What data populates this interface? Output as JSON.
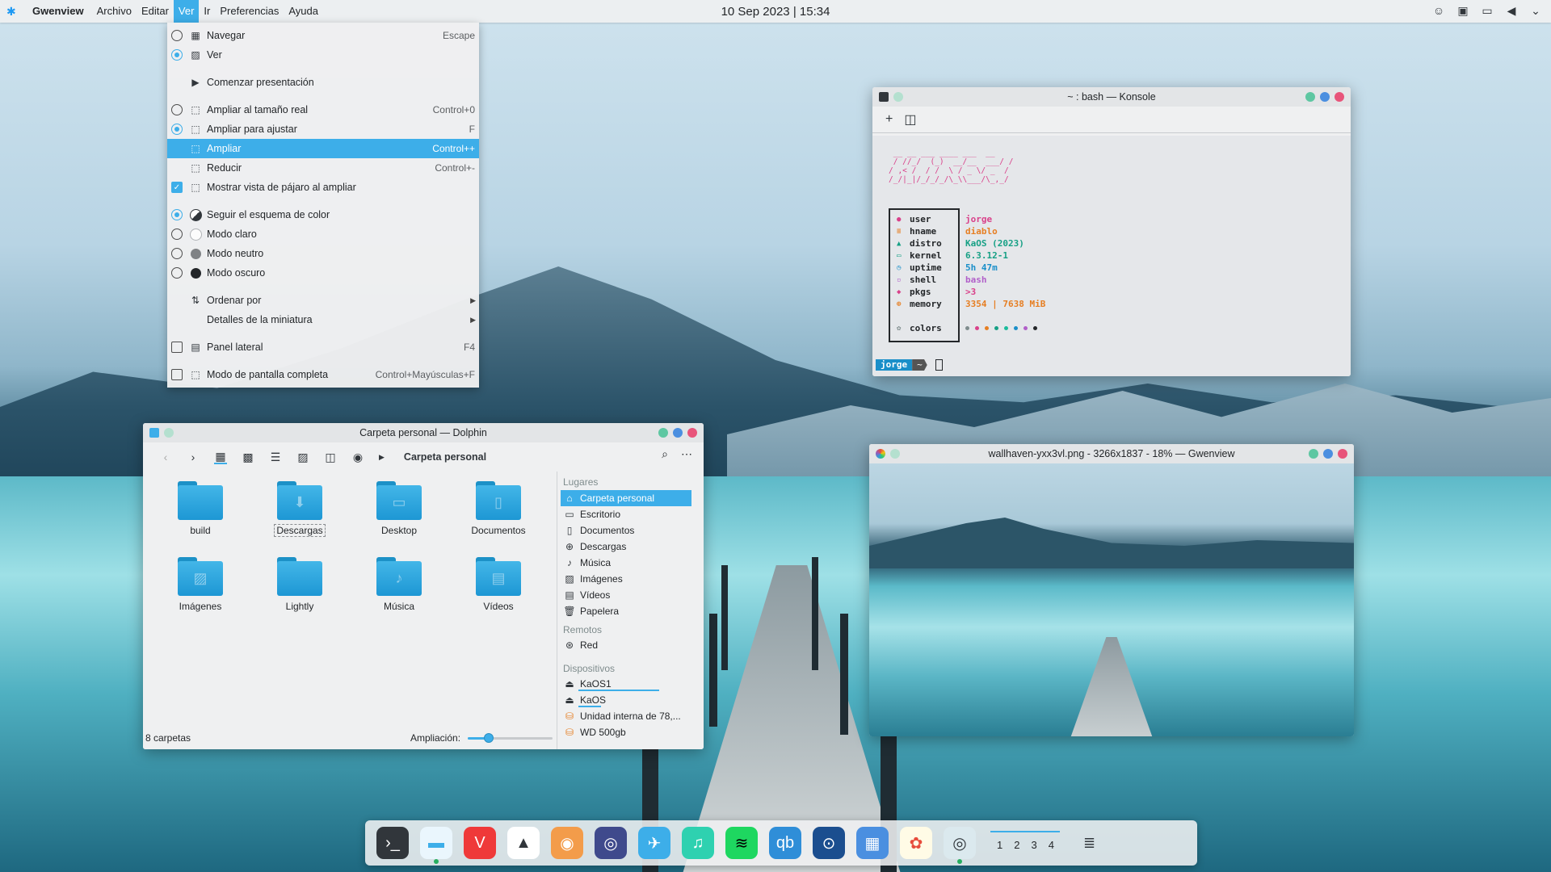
{
  "topbar": {
    "app_name": "Gwenview",
    "menus": [
      "Archivo",
      "Editar",
      "Ver",
      "Ir",
      "Preferencias",
      "Ayuda"
    ],
    "active_menu": "Ver",
    "clock": "10 Sep 2023 | 15:34"
  },
  "view_menu": {
    "items": [
      {
        "label": "Navegar",
        "shortcut": "Escape"
      },
      {
        "label": "Ver",
        "shortcut": ""
      },
      {
        "label": "Comenzar presentación",
        "shortcut": ""
      },
      {
        "label": "Ampliar al tamaño real",
        "shortcut": "Control+0"
      },
      {
        "label": "Ampliar para ajustar",
        "shortcut": "F"
      },
      {
        "label": "Ampliar",
        "shortcut": "Control++"
      },
      {
        "label": "Reducir",
        "shortcut": "Control+-"
      },
      {
        "label": "Mostrar vista de pájaro al ampliar",
        "shortcut": ""
      },
      {
        "label": "Seguir el esquema de color",
        "shortcut": ""
      },
      {
        "label": "Modo claro",
        "shortcut": ""
      },
      {
        "label": "Modo neutro",
        "shortcut": ""
      },
      {
        "label": "Modo oscuro",
        "shortcut": ""
      },
      {
        "label": "Ordenar por",
        "shortcut": ""
      },
      {
        "label": "Detalles de la miniatura",
        "shortcut": ""
      },
      {
        "label": "Panel lateral",
        "shortcut": "F4"
      },
      {
        "label": "Modo de pantalla completa",
        "shortcut": "Control+Mayúsculas+F"
      }
    ]
  },
  "konsole": {
    "title": "~ : bash — Konsole",
    "info": [
      {
        "key": "user",
        "value": "jorge",
        "color": "#d9418a"
      },
      {
        "key": "hname",
        "value": "diablo",
        "color": "#e67e22"
      },
      {
        "key": "distro",
        "value": "KaOS (2023)",
        "color": "#16a085"
      },
      {
        "key": "kernel",
        "value": "6.3.12-1",
        "color": "#16a085"
      },
      {
        "key": "uptime",
        "value": "5h 47m",
        "color": "#1a8fc9"
      },
      {
        "key": "shell",
        "value": "bash",
        "color": "#b15fc9"
      },
      {
        "key": "pkgs",
        "value": ">3",
        "color": "#d9418a"
      },
      {
        "key": "memory",
        "value": "3354 | 7638 MiB",
        "color": "#e67e22"
      }
    ],
    "colors_label": "colors",
    "prompt_user": "jorge",
    "prompt_dir": "~"
  },
  "dolphin": {
    "title": "Carpeta personal — Dolphin",
    "breadcrumb": "Carpeta personal",
    "folders": [
      "build",
      "Descargas",
      "Desktop",
      "Documentos",
      "Imágenes",
      "Lightly",
      "Música",
      "Vídeos"
    ],
    "status": "8 carpetas",
    "zoom_label": "Ampliación:",
    "zoom_level": 0.25,
    "places_header": "Lugares",
    "places": [
      "Carpeta personal",
      "Escritorio",
      "Documentos",
      "Descargas",
      "Música",
      "Imágenes",
      "Vídeos",
      "Papelera"
    ],
    "remote_header": "Remotos",
    "remote": [
      "Red"
    ],
    "devices_header": "Dispositivos",
    "devices": [
      "KaOS1",
      "KaOS",
      "Unidad interna de 78,...",
      "WD 500gb"
    ]
  },
  "gwenview": {
    "title": "wallhaven-yxx3vl.png - 3266x1837 - 18% — Gwenview"
  },
  "dock": {
    "pager": [
      "1",
      "2",
      "3",
      "4"
    ]
  }
}
